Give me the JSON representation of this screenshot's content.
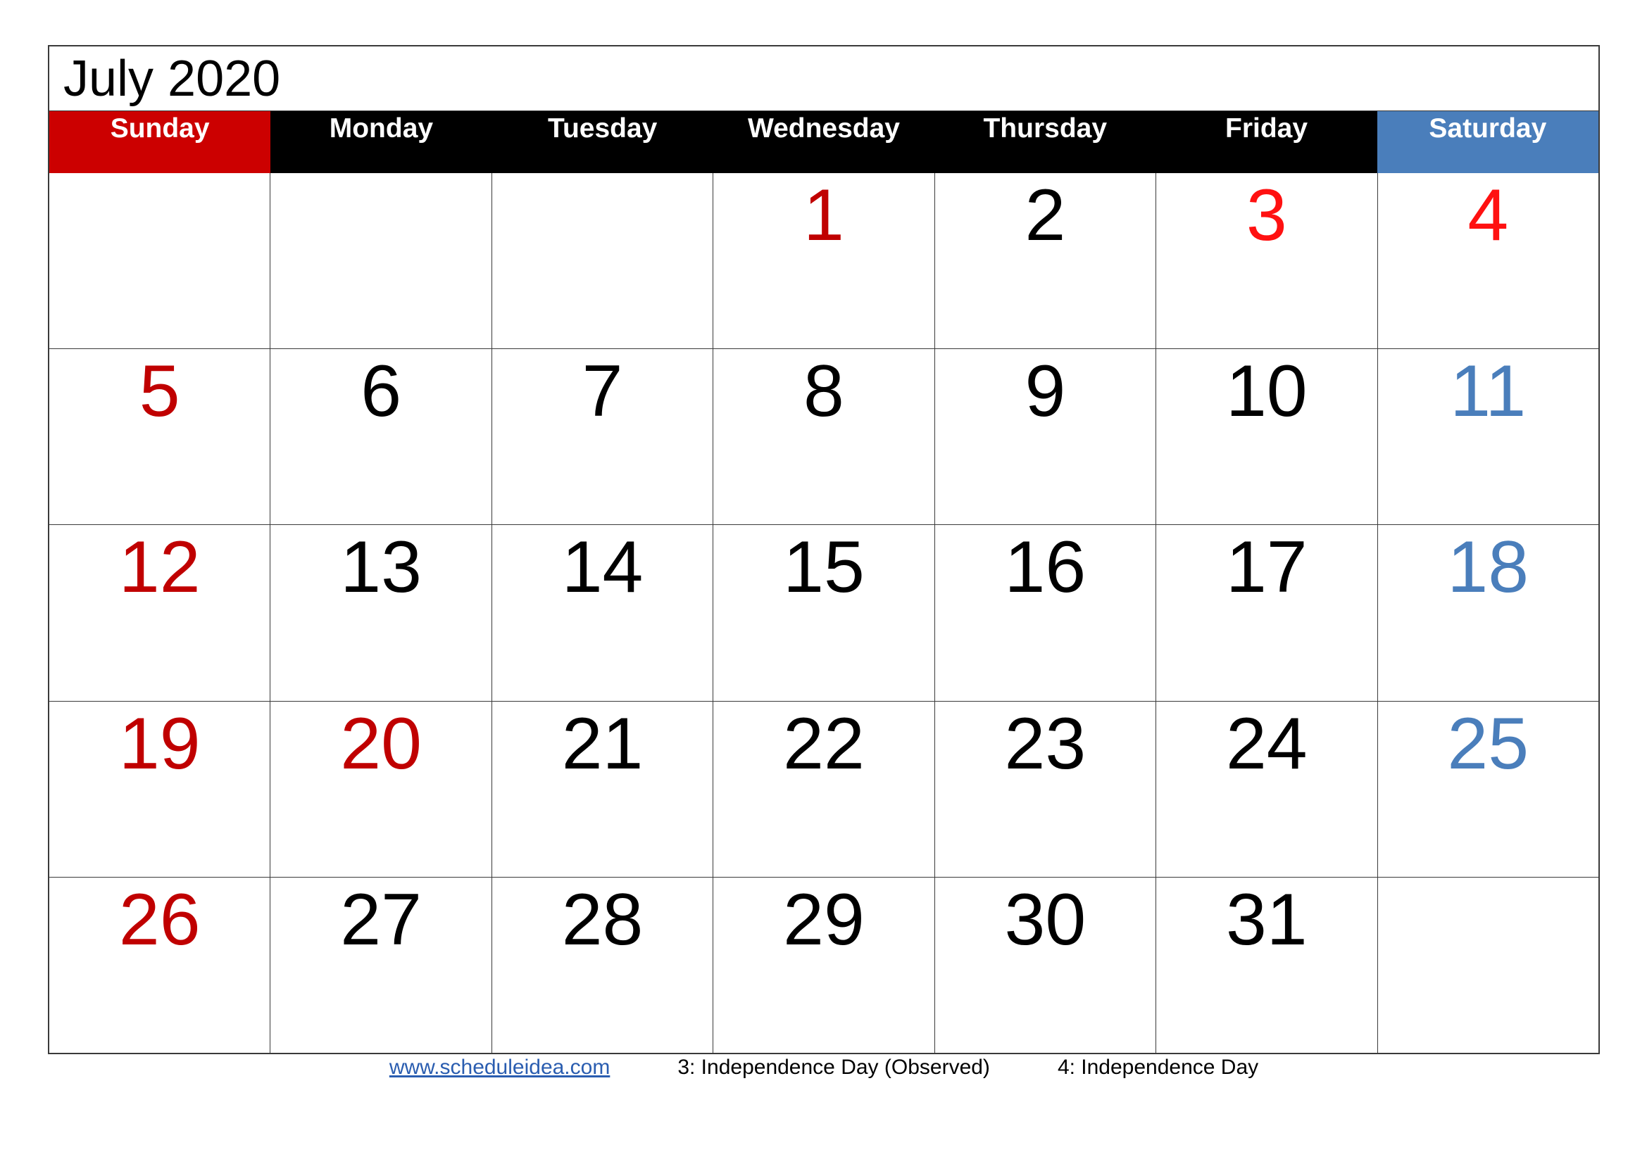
{
  "page_title": "July 2020",
  "colors": {
    "sunday_header_bg": "#CC0000",
    "weekday_header_bg": "#000000",
    "saturday_header_bg": "#4A7EBB",
    "header_text": "#FFFFFF",
    "sunday_date": "#C00000",
    "saturday_date": "#4A7EBB",
    "weekday_date": "#000000",
    "holiday_date": "#FF1111",
    "link": "#2A5DB0",
    "grid_line": "#3A3A3A",
    "cell_bg": "#FFFFFF"
  },
  "weekdays": [
    {
      "label": "Sunday",
      "style": "sunday"
    },
    {
      "label": "Monday",
      "style": "weekday"
    },
    {
      "label": "Tuesday",
      "style": "weekday"
    },
    {
      "label": "Wednesday",
      "style": "weekday"
    },
    {
      "label": "Thursday",
      "style": "weekday"
    },
    {
      "label": "Friday",
      "style": "weekday"
    },
    {
      "label": "Saturday",
      "style": "saturday"
    }
  ],
  "weeks": [
    [
      {
        "day": "",
        "color": "c-black"
      },
      {
        "day": "",
        "color": "c-black"
      },
      {
        "day": "",
        "color": "c-black"
      },
      {
        "day": "1",
        "color": "c-red"
      },
      {
        "day": "2",
        "color": "c-black"
      },
      {
        "day": "3",
        "color": "c-holiday"
      },
      {
        "day": "4",
        "color": "c-holiday"
      }
    ],
    [
      {
        "day": "5",
        "color": "c-red"
      },
      {
        "day": "6",
        "color": "c-black"
      },
      {
        "day": "7",
        "color": "c-black"
      },
      {
        "day": "8",
        "color": "c-black"
      },
      {
        "day": "9",
        "color": "c-black"
      },
      {
        "day": "10",
        "color": "c-black"
      },
      {
        "day": "11",
        "color": "c-blue"
      }
    ],
    [
      {
        "day": "12",
        "color": "c-red"
      },
      {
        "day": "13",
        "color": "c-black"
      },
      {
        "day": "14",
        "color": "c-black"
      },
      {
        "day": "15",
        "color": "c-black"
      },
      {
        "day": "16",
        "color": "c-black"
      },
      {
        "day": "17",
        "color": "c-black"
      },
      {
        "day": "18",
        "color": "c-blue"
      }
    ],
    [
      {
        "day": "19",
        "color": "c-red"
      },
      {
        "day": "20",
        "color": "c-red"
      },
      {
        "day": "21",
        "color": "c-black"
      },
      {
        "day": "22",
        "color": "c-black"
      },
      {
        "day": "23",
        "color": "c-black"
      },
      {
        "day": "24",
        "color": "c-black"
      },
      {
        "day": "25",
        "color": "c-blue"
      }
    ],
    [
      {
        "day": "26",
        "color": "c-red"
      },
      {
        "day": "27",
        "color": "c-black"
      },
      {
        "day": "28",
        "color": "c-black"
      },
      {
        "day": "29",
        "color": "c-black"
      },
      {
        "day": "30",
        "color": "c-black"
      },
      {
        "day": "31",
        "color": "c-black"
      },
      {
        "day": "",
        "color": "c-black"
      }
    ]
  ],
  "footer": {
    "link_text": "www.scheduleidea.com",
    "note_1": "3: Independence Day (Observed)",
    "note_2": "4: Independence Day"
  }
}
